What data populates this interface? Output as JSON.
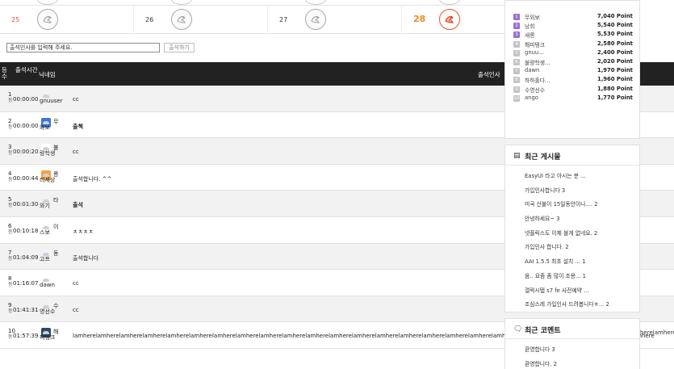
{
  "calendar": {
    "days": [
      {
        "day": "25",
        "type": "sun",
        "stamp_active": false
      },
      {
        "day": "26",
        "type": "normal",
        "stamp_active": false
      },
      {
        "day": "27",
        "type": "normal",
        "stamp_active": false
      },
      {
        "day": "28",
        "type": "sat",
        "stamp_active": true
      }
    ]
  },
  "greeting": {
    "input_value": "출석인사를 입력해 주세요.",
    "submit_label": "출석하기"
  },
  "table": {
    "headers": {
      "rank": "등수",
      "time": "출석시간",
      "nickname": "닉네임",
      "greeting": "출석인사"
    },
    "rows": [
      {
        "rank": "1",
        "unit": "등",
        "time": "00:00:00",
        "nick_a": "",
        "nick_b": "gnuuser",
        "avatar": "default",
        "message": "cc",
        "bold": false
      },
      {
        "rank": "2",
        "unit": "등",
        "time": "00:00:00",
        "nick_a": "무",
        "nick_b": "와보",
        "avatar": "blue",
        "message": "출첵",
        "bold": true
      },
      {
        "rank": "3",
        "unit": "등",
        "time": "00:00:20",
        "nick_a": "불",
        "nick_b": "량학생",
        "avatar": "sketch",
        "message": "cc",
        "bold": false
      },
      {
        "rank": "4",
        "unit": "등",
        "time": "00:00:44",
        "nick_a": "롱",
        "nick_b": "리세상",
        "avatar": "orange",
        "message": "출석합니다. ^^",
        "bold": false
      },
      {
        "rank": "5",
        "unit": "등",
        "time": "00:01:30",
        "nick_a": "타",
        "nick_b": "와기",
        "avatar": "default",
        "message": "출석",
        "bold": true
      },
      {
        "rank": "6",
        "unit": "등",
        "time": "00:10:18",
        "nick_a": "이",
        "nick_b": "스보",
        "avatar": "default",
        "message": "ㅊㅊㅊㅊ",
        "bold": false
      },
      {
        "rank": "7",
        "unit": "등",
        "time": "01:04:09",
        "nick_a": "동",
        "nick_b": "고프",
        "avatar": "default",
        "message": "출석합니다",
        "bold": false
      },
      {
        "rank": "8",
        "unit": "등",
        "time": "01:16:07",
        "nick_a": "",
        "nick_b": "dawn",
        "avatar": "default",
        "message": "cc",
        "bold": false
      },
      {
        "rank": "9",
        "unit": "등",
        "time": "01:41:31",
        "nick_a": "수",
        "nick_b": "영선수",
        "avatar": "default",
        "message": "cc",
        "bold": false
      },
      {
        "rank": "10",
        "unit": "등",
        "time": "01:57:39",
        "nick_a": "해",
        "nick_b": "피텡크",
        "avatar": "photo",
        "message": "lamherelamherelamherelamherelamherelamherelamherelamherelamherelamherelamherelamherelamherelamherelamherelamherelamherelamherelamherelamherelamherelamherelamherelamherelamhere",
        "bold": false
      }
    ],
    "overflow_tail": "herelamhere"
  },
  "point_ranking": {
    "items": [
      {
        "badge": "1",
        "name": "무외보",
        "points": "7,040 Point",
        "color": "#9b6fd6"
      },
      {
        "badge": "2",
        "name": "낭희",
        "points": "5,540 Point",
        "color": "#9b6fd6"
      },
      {
        "badge": "3",
        "name": "새롱",
        "points": "5,530 Point",
        "color": "#9b6fd6"
      },
      {
        "badge": "4",
        "name": "해피텡크",
        "points": "2,580 Point",
        "color": "#c4c4c4"
      },
      {
        "badge": "5",
        "name": "gnuu...",
        "points": "2,400 Point",
        "color": "#c4c4c4"
      },
      {
        "badge": "6",
        "name": "불량학생...",
        "points": "2,020 Point",
        "color": "#c4c4c4"
      },
      {
        "badge": "7",
        "name": "dawn",
        "points": "1,970 Point",
        "color": "#c4c4c4"
      },
      {
        "badge": "8",
        "name": "하하훌다...",
        "points": "1,960 Point",
        "color": "#c4c4c4"
      },
      {
        "badge": "9",
        "name": "수영선수",
        "points": "1,880 Point",
        "color": "#c4c4c4"
      },
      {
        "badge": "10",
        "name": "ango",
        "points": "1,770 Point",
        "color": "#c4c4c4"
      }
    ]
  },
  "recent_posts": {
    "title": "최근 게시물",
    "items": [
      "EasyUI 라고 아시는 분 ...",
      "가입인사합니다 3",
      "미국 산불이 15일동안이나.... 2",
      "안녕하세요~ 3",
      "넷플릭스도 이제 볼게 없네요. 2",
      "가입인사 합니다. 2",
      "AAI 1.5.5 최초 설치 ... 1",
      "음.. 요즘 좀 많이 조용... 1",
      "갤럭시탭 s7 fe 사전예약 ...",
      "조심스레 가입인사 드려봅니다ㅎ... 2"
    ]
  },
  "recent_comments": {
    "title": "최근 코멘트",
    "items": [
      "환영합니다 3",
      "환영합니다. 2"
    ]
  }
}
